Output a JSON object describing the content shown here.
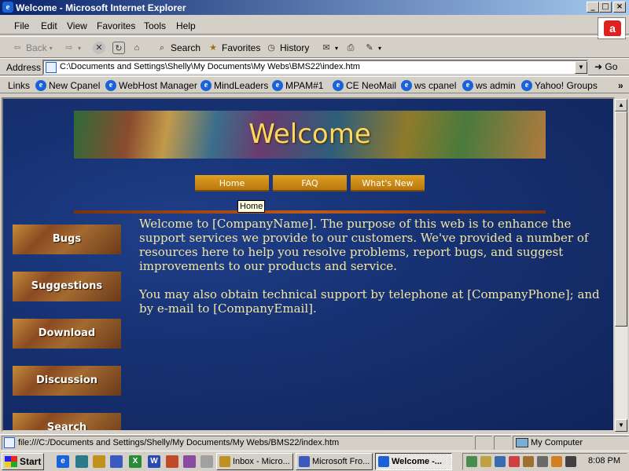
{
  "window": {
    "title": "Welcome - Microsoft Internet Explorer",
    "controls": {
      "minimize": "_",
      "maximize": "□",
      "close": "×"
    }
  },
  "menu": [
    "File",
    "Edit",
    "View",
    "Favorites",
    "Tools",
    "Help"
  ],
  "toolbar": {
    "back": "Back",
    "search": "Search",
    "favorites": "Favorites",
    "history": "History"
  },
  "address": {
    "label": "Address",
    "value": "C:\\Documents and Settings\\Shelly\\My Documents\\My Webs\\BMS22\\index.htm",
    "go": "Go"
  },
  "links": {
    "label": "Links",
    "items": [
      "New Cpanel",
      "WebHost Manager",
      "MindLeaders",
      "MPAM#1",
      "CE NeoMail",
      "ws cpanel",
      "ws admin",
      "Yahoo! Groups"
    ],
    "more": "»"
  },
  "page": {
    "banner_title": "Welcome",
    "nav": [
      "Home",
      "FAQ",
      "What's New"
    ],
    "tooltip": "Home",
    "side_buttons": [
      "Bugs",
      "Suggestions",
      "Download",
      "Discussion",
      "Search"
    ],
    "paragraphs": [
      "Welcome to [CompanyName]. The purpose of this web is to enhance the support services we provide to our customers. We've provided a number of resources here to help you resolve problems, report bugs, and suggest improvements to our products and service.",
      "You may also obtain technical support by telephone at [CompanyPhone]; and by e-mail to [CompanyEmail]."
    ]
  },
  "status": {
    "text": "file:///C:/Documents and Settings/Shelly/My Documents/My Webs/BMS22/index.htm",
    "zone": "My Computer"
  },
  "taskbar": {
    "start": "Start",
    "tasks": [
      "Inbox - Micro...",
      "Microsoft Fro...",
      "Welcome -..."
    ],
    "active_task": 2,
    "clock": "8:08 PM"
  },
  "icons": {
    "brand_colors": {
      "title_bar": "#0a246a",
      "page_bg": "#173273",
      "nav_gold": "#d08c18",
      "body_text": "#f2e6a6"
    }
  }
}
